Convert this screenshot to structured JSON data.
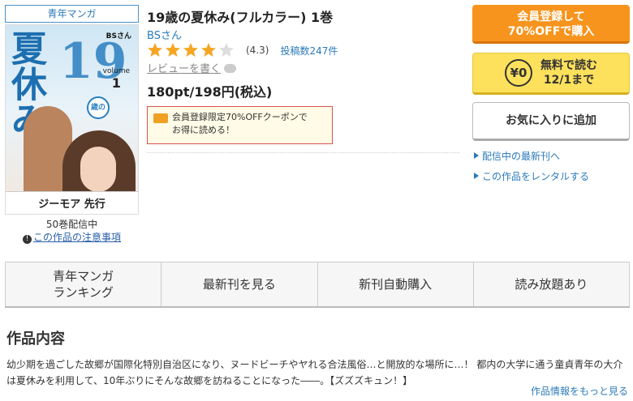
{
  "genre_tag": "青年マンガ",
  "cover": {
    "author_small": "BSさん",
    "title_glyphs": "夏休み",
    "number": "19",
    "circle_char": "歳の",
    "volume_prefix": "volume",
    "volume_number": "1",
    "label_band": "ジーモア 先行"
  },
  "volume_count": "50巻配信中",
  "caution_link": "この作品の注意事項",
  "book": {
    "title": "19歳の夏休み(フルカラー) 1巻",
    "author": "BSさん",
    "rating_value": "(4.3)",
    "rating_stars": 4.3,
    "post_count": "投稿数247件",
    "review_link": "レビューを書く",
    "price": "180pt/198円(税込)"
  },
  "coupon": {
    "line1": "会員登録限定70%OFFクーポンで",
    "line2": "お得に読める！"
  },
  "buttons": {
    "register_line1": "会員登録して",
    "register_line2": "70%OFFで購入",
    "free_yen": "¥0",
    "free_line1": "無料で読む",
    "free_line2": "12/1まで",
    "favorite": "お気に入りに追加"
  },
  "side_links": [
    "配信中の最新刊へ",
    "この作品をレンタルする"
  ],
  "tabs": [
    {
      "line1": "青年マンガ",
      "line2": "ランキング"
    },
    {
      "line1": "最新刊を見る",
      "line2": ""
    },
    {
      "line1": "新刊自動購入",
      "line2": ""
    },
    {
      "line1": "読み放題あり",
      "line2": ""
    }
  ],
  "section_title": "作品内容",
  "description_line1": "幼少期を過ごした故郷が国際化特別自治区になり、ヌードビーチやヤれる合法風俗…と開放的な場所に…！ 都内の大学に通う童貞青年の大介",
  "description_line2": "は夏休みを利用して、10年ぶりにそんな故郷を訪ねることになった――。【ズズズキュン！】",
  "more_link": "作品情報をもっと見る",
  "colors": {
    "accent_blue": "#2b7ab8",
    "register_orange": "#f7941d",
    "free_yellow": "#fde15c",
    "star_gold": "#f5a623",
    "coupon_border": "#d9534f"
  }
}
